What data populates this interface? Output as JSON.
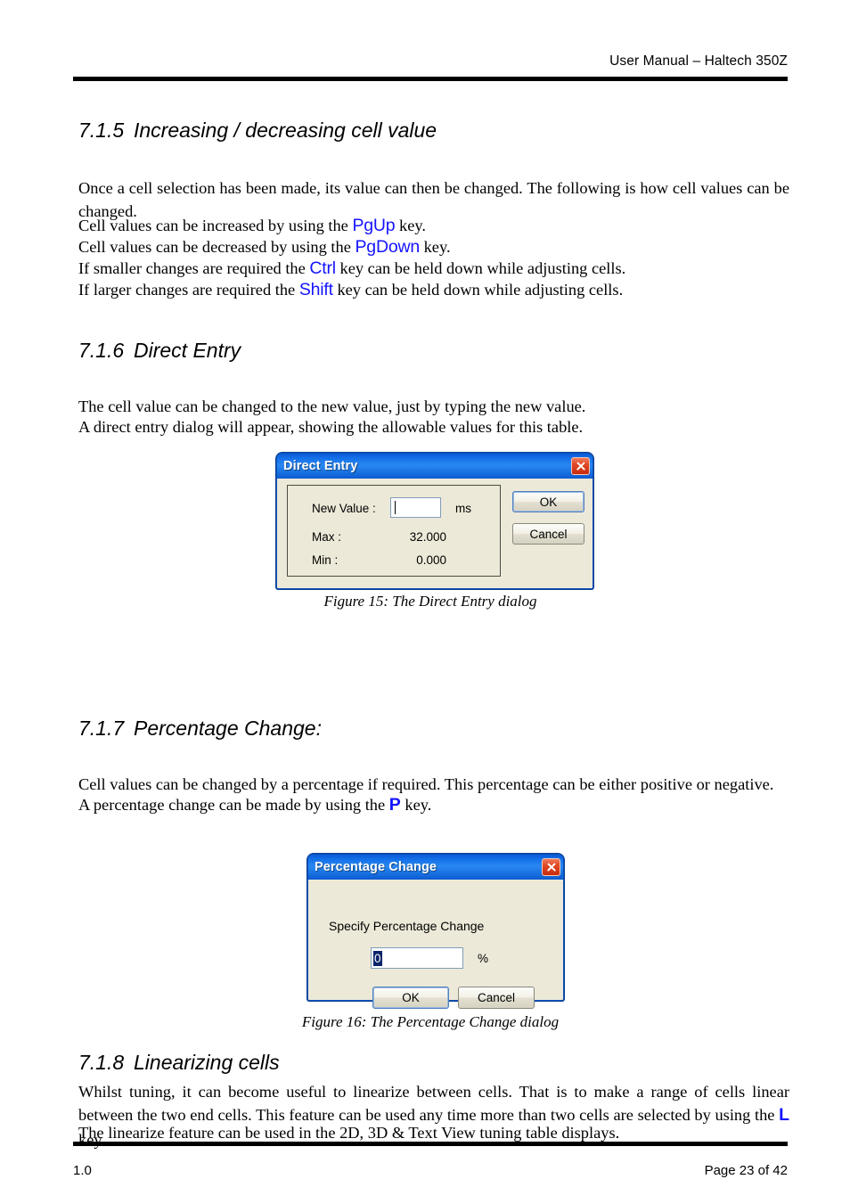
{
  "header": {
    "title": "User Manual – Haltech 350Z"
  },
  "footer": {
    "version": "1.0",
    "page": "Page 23 of 42"
  },
  "sections": {
    "s715": {
      "number": "7.1.5",
      "title": "Increasing / decreasing cell value",
      "para1": "Once a cell selection has been made, its value can then be changed. The following is how cell values can be changed.",
      "line2_pre": "Cell values can be increased by using the ",
      "line2_key": "PgUp",
      "line2_post": " key.",
      "line3_pre": "Cell values can be decreased by using the ",
      "line3_key": "PgDown",
      "line3_post": " key.",
      "line4_pre": "If smaller changes are required the ",
      "line4_key": "Ctrl",
      "line4_post": " key can be held down while adjusting cells.",
      "line5_pre": "If larger changes are required the ",
      "line5_key": "Shift",
      "line5_post": " key can be held down while adjusting cells."
    },
    "s716": {
      "number": "7.1.6",
      "title": "Direct Entry",
      "line1": "The cell value can be changed to the new value, just by typing the new value.",
      "line2": "A direct entry dialog will appear, showing the allowable values for this table."
    },
    "s717": {
      "number": "7.1.7",
      "title": "Percentage Change:",
      "line1": "Cell values can be changed by a percentage if required. This percentage can be either positive or negative.",
      "line2_pre": "A percentage change can be made by using the ",
      "line2_key": "P",
      "line2_post": " key."
    },
    "s718": {
      "number": "7.1.8",
      "title": "Linearizing cells",
      "para_pre": "Whilst tuning, it can become useful to linearize between cells. That is to make a range of cells linear between the two end cells. This feature can be used any time more than two cells are selected by using the ",
      "para_key": "L",
      "para_post": " key.",
      "line3": "The linearize feature can be used in the 2D, 3D & Text View tuning table displays."
    }
  },
  "figures": {
    "fig15": {
      "caption": "Figure 15: The Direct Entry dialog"
    },
    "fig16": {
      "caption": "Figure 16: The Percentage Change dialog"
    }
  },
  "direct_entry_dialog": {
    "title": "Direct Entry",
    "close_label": "×",
    "new_value_label": "New Value :",
    "new_value_input": "",
    "unit": "ms",
    "max_label": "Max :",
    "max_value": "32.000",
    "min_label": "Min :",
    "min_value": "0.000",
    "ok_label": "OK",
    "cancel_label": "Cancel"
  },
  "percentage_dialog": {
    "title": "Percentage Change",
    "close_label": "×",
    "prompt": "Specify Percentage Change",
    "input_value": "0",
    "unit": "%",
    "ok_label": "OK",
    "cancel_label": "Cancel"
  },
  "colors": {
    "key_blue": "#1414ff",
    "titlebar_blue": "#1470e8",
    "dialog_face": "#ece9d8",
    "close_red": "#e04826"
  }
}
